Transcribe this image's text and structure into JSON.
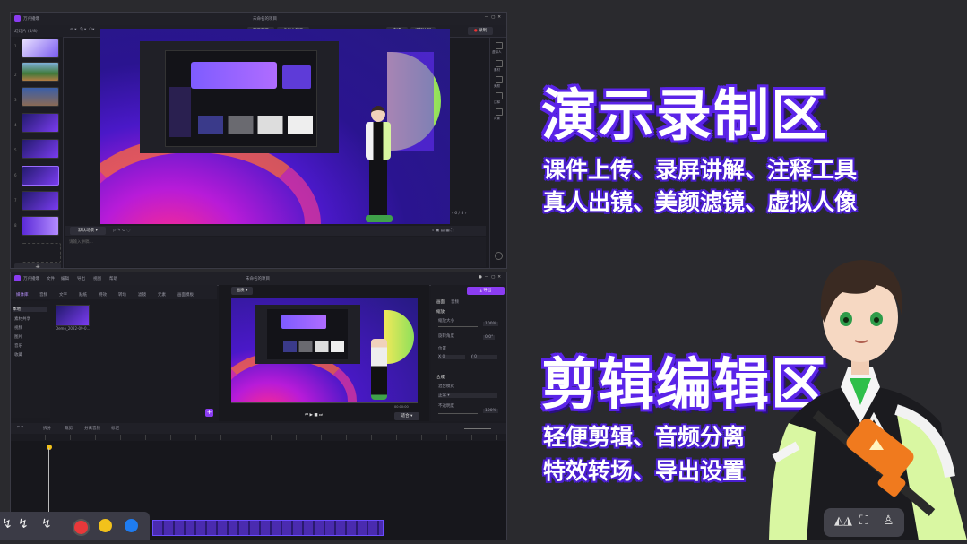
{
  "headline1": "演示录制区",
  "subline1a": "课件上传、录屏讲解、注释工具",
  "subline1b": "真人出镜、美颜滤镜、虚拟人像",
  "headline2": "剪辑编辑区",
  "subline2a": "轻便剪辑、音频分离",
  "subline2b": "特效转场、导出设置",
  "recorder": {
    "app_name": "万兴播爆",
    "window_title": "未命名的项目",
    "slides_header": "幻灯片 (5/8)",
    "top_tabs": [
      "演示演示",
      "虚拟人演示"
    ],
    "top_actions": [
      "直播",
      "视频协同",
      "录制"
    ],
    "right_tools": [
      "虚拟人",
      "素材",
      "美颜",
      "注释",
      "背景"
    ],
    "page_indicator": "6 / 8",
    "notes_placeholder": "请输入讲稿...",
    "bottom_select": "默认场景",
    "slide_numbers": [
      "1",
      "2",
      "3",
      "4",
      "5",
      "6",
      "7",
      "8"
    ],
    "add_label": "+"
  },
  "editor": {
    "app_name": "万兴播爆",
    "menu": [
      "文件",
      "编辑",
      "导出",
      "视图",
      "帮助"
    ],
    "window_title": "未命名的项目",
    "export_label": "导出",
    "media_tabs": [
      "媒体库",
      "音频",
      "文字",
      "贴纸",
      "特效",
      "转场",
      "滤镜",
      "元素",
      "画面模板"
    ],
    "media_sidebar": [
      "本地",
      "素材共享",
      "视频",
      "图片",
      "音乐",
      "收藏"
    ],
    "clip_name": "Demo_2022-09-0...",
    "panel_tabs": [
      "画面",
      "音频"
    ],
    "panel_section1": "缩放",
    "panel_rows": [
      {
        "label": "缩放大小",
        "value": "100%"
      },
      {
        "label": "旋转角度",
        "value": "0.0°"
      },
      {
        "label": "位置",
        "value": ""
      }
    ],
    "pos_x": "X 0",
    "pos_y": "Y 0",
    "panel_section2": "合成",
    "blend_label": "混合模式",
    "blend_value": "正常",
    "opacity_label": "不透明度",
    "opacity_value": "100%",
    "preview_time": "00:00:00",
    "quality_label": "画质",
    "zoom_select": "适合",
    "timeline_tools": [
      "拆分",
      "分离音频",
      "裁剪",
      "标记"
    ]
  },
  "toolbar_bottom": {
    "colors": [
      "#e8383a",
      "#f2c21b",
      "#1f7cf0"
    ]
  },
  "avatar_panel_icons": [
    "mirror-icon",
    "fullscreen-icon",
    "person-icon"
  ]
}
